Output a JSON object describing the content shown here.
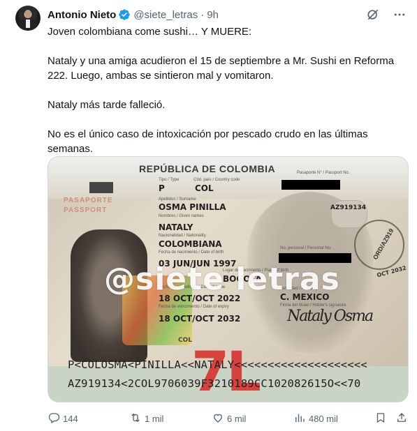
{
  "tweet": {
    "author_name": "Antonio Nieto",
    "handle": "@siete_letras",
    "separator": "·",
    "time": "9h",
    "text": [
      "Joven colombiana come sushi… Y MUERE:",
      "Nataly y una amiga acudieron el 15 de septiembre a Mr. Sushi en Reforma 222. Luego, ambas se sintieron mal y vomitaron.",
      "Nataly más tarde falleció.",
      "No es el único caso de intoxicación por pescado crudo en las últimas semanas."
    ]
  },
  "media": {
    "heading": "REPÚBLICA DE COLOMBIA",
    "passaporte": "PASAPORTE",
    "passport": "PASSPORT",
    "sub_type": "Tipo / Type",
    "sub_code": "Cód. país / Country code",
    "sub_no": "Pasaporte N° / Passport No.",
    "val_type": "P",
    "val_code": "COL",
    "sub_surname": "Apellidos / Surname",
    "val_surname": "OSMA PINILLA",
    "sub_names": "Nombres / Given names",
    "val_names": "NATALY",
    "sub_nationality": "Nacionalidad / Nationality",
    "val_nationality": "COLOMBIANA",
    "sub_dob": "Fecha de nacimiento / Date of birth",
    "val_dob": "03 JUN/JUN 1997",
    "sub_pob": "Lugar de nacimiento / Place of birth",
    "val_pob": "BOGOTÁ",
    "sub_issue": "Fecha de expedición / Date of issue",
    "val_issue": "18 OCT/OCT 2022",
    "sub_expiry": "Fecha de vencimiento / Date of expiry",
    "val_expiry": "18 OCT/OCT 2032",
    "passport_no_small": "AZ919134",
    "sub_personal": "No. personal / Personal No.",
    "sub_authority": "Autoridad / Authority",
    "val_authority": "C. MEXICO",
    "sub_signature": "Firma del titular / Holder's signature",
    "holo_text": "COL",
    "stamp_text": "ORD/AZ919",
    "stamp_text2": "OCT 2032",
    "signature": "Nataly Osma",
    "watermark": "@siete letras",
    "logo": "7L",
    "mrz_line1": "P<COLOSMA<PINILLA<<NATALY<<<<<<<<<<<<<<<<<<<<",
    "mrz_line2": "AZ919134<2COL9706039F3210189CC102082615O<<70"
  },
  "actions": {
    "replies": "144",
    "retweets": "1 mil",
    "likes": "6 mil",
    "views": "480 mil"
  },
  "icons": {
    "verified": "verified-badge-icon",
    "grok": "grok-icon",
    "more": "more-icon",
    "reply": "reply-icon",
    "retweet": "retweet-icon",
    "like": "like-icon",
    "views": "views-icon",
    "bookmark": "bookmark-icon",
    "share": "share-icon"
  },
  "colors": {
    "text": "#0f1419",
    "secondary": "#536471",
    "verified": "#1d9bf0",
    "border": "#cfd9de"
  }
}
